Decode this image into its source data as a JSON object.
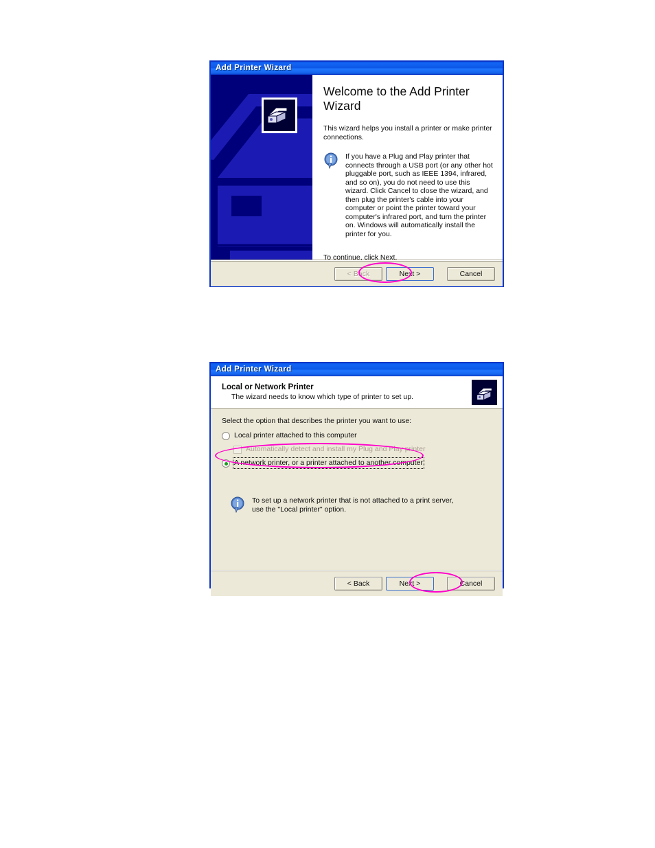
{
  "page": {
    "background_color": "#ffffff",
    "annotation_color": "#ff00cc"
  },
  "dialog_welcome": {
    "title": "Add Printer Wizard",
    "heading": "Welcome to the Add Printer Wizard",
    "intro": "This wizard helps you install a printer or make printer connections.",
    "info_icon": "info-icon",
    "info_text": "If you have a Plug and Play printer that connects through a USB port (or any other hot pluggable port, such as IEEE 1394, infrared, and so on), you do not need to use this wizard. Click Cancel to close the wizard, and then plug the printer's cable into your computer or point the printer toward your computer's infrared port, and turn the printer on. Windows will automatically install the printer for you.",
    "outro": "To continue, click Next.",
    "banner_icon": "printer-icon",
    "buttons": {
      "back": "< Back",
      "next": "Next >",
      "cancel": "Cancel",
      "back_enabled": "false",
      "next_default": "true"
    },
    "annotation": "ellipse-around-back-button"
  },
  "dialog_local_network": {
    "title": "Add Printer Wizard",
    "header_title": "Local or Network Printer",
    "header_subtitle": "The wizard needs to know which type of printer to set up.",
    "header_icon": "printer-icon",
    "prompt": "Select the option that describes the printer you want to use:",
    "options": [
      {
        "type": "radio",
        "label": "Local printer attached to this computer",
        "checked": "false",
        "disabled": "false"
      },
      {
        "type": "checkbox",
        "label": "Automatically detect and install my Plug and Play printer",
        "checked": "false",
        "disabled": "true"
      },
      {
        "type": "radio",
        "label": "A network printer, or a printer attached to another computer",
        "checked": "true",
        "disabled": "false"
      }
    ],
    "info_icon": "info-icon",
    "info_text": "To set up a network printer that is not attached to a print server, use the \"Local printer\" option.",
    "buttons": {
      "back": "< Back",
      "next": "Next >",
      "cancel": "Cancel",
      "back_enabled": "true",
      "next_default": "true"
    },
    "annotations": [
      "ellipse-around-network-printer-option",
      "ellipse-around-next-button"
    ]
  }
}
